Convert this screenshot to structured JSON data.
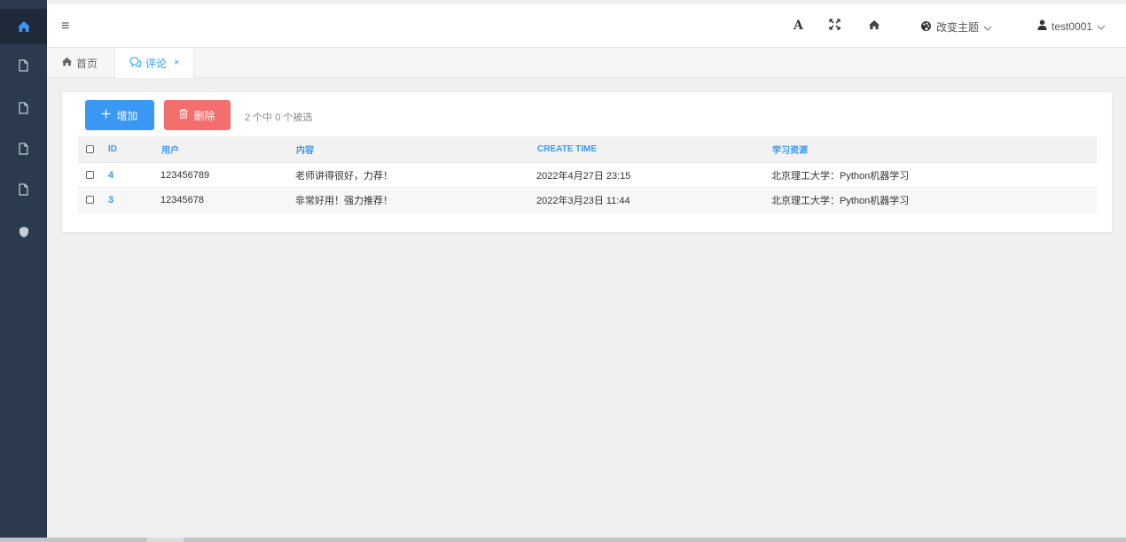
{
  "sidebar": {
    "items": [
      {
        "icon": "home-icon",
        "active": true
      },
      {
        "icon": "file-icon"
      },
      {
        "icon": "file-icon"
      },
      {
        "icon": "file-icon"
      },
      {
        "icon": "file-icon"
      },
      {
        "icon": "shield-icon"
      }
    ]
  },
  "topbar": {
    "font_icon": "A",
    "theme_label": "改变主题",
    "user_label": "test0001"
  },
  "tabs": {
    "home_label": "首页",
    "comment_label": "评论",
    "close_glyph": "×"
  },
  "toolbar": {
    "add_label": "增加",
    "delete_label": "删除",
    "selection_info": "2 个中 0 个被选"
  },
  "table": {
    "headers": {
      "id": "ID",
      "user": "用户",
      "content": "内容",
      "create_time": "CREATE TIME",
      "resource": "学习资源"
    },
    "rows": [
      {
        "id": "4",
        "user": "123456789",
        "content": "老师讲得很好，力荐！",
        "create_time": "2022年4月27日 23:15",
        "resource": "北京理工大学：Python机器学习"
      },
      {
        "id": "3",
        "user": "12345678",
        "content": "非常好用！强力推荐！",
        "create_time": "2022年3月23日 11:44",
        "resource": "北京理工大学：Python机器学习"
      }
    ]
  },
  "colors": {
    "sidebar_bg": "#2b3a4e",
    "primary": "#3a97f4",
    "danger": "#f46e6e",
    "tab_active": "#1e9fff"
  }
}
